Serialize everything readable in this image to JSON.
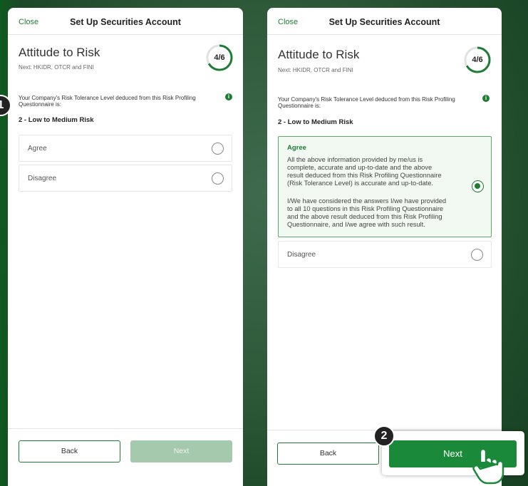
{
  "colors": {
    "brand_green": "#1e7d34",
    "next_active": "#1a8a3a",
    "next_disabled": "#a5c9ad",
    "background": "#2e5a3a"
  },
  "left_screen": {
    "close_label": "Close",
    "title": "Set Up Securities Account",
    "step_title": "Attitude to Risk",
    "step_next": "Next: HKIDR, OTCR and FINI",
    "progress_label": "4/6",
    "progress_fraction": 0.667,
    "question": "Your Company's Risk Tolerance Level deduced from this Risk Profiling Questionnaire is:",
    "info_icon": "info-icon",
    "result": "2 - Low to Medium Risk",
    "options": [
      {
        "label": "Agree",
        "selected": false
      },
      {
        "label": "Disagree",
        "selected": false
      }
    ],
    "back_label": "Back",
    "next_label": "Next",
    "badge": "1"
  },
  "right_screen": {
    "close_label": "Close",
    "title": "Set Up Securities Account",
    "step_title": "Attitude to Risk",
    "step_next": "Next: HKIDR, OTCR and FINI",
    "progress_label": "4/6",
    "progress_fraction": 0.667,
    "question": "Your Company's Risk Tolerance Level deduced from this Risk Profiling Questionnaire is:",
    "result": "2 - Low to Medium Risk",
    "agree": {
      "label": "Agree",
      "line1": "All the above information provided by me/us is",
      "line2": "complete, accurate and up-to-date and the above",
      "line3": "result deduced from this Risk Profiling Questionnaire",
      "line4": "(Risk Tolerance Level) is accurate and up-to-date.",
      "line5": "I/We have considered the answers I/we have provided",
      "line6": "to all 10 questions in this Risk Profiling Questionnaire",
      "line7": "and the above result deduced from this Risk Profiling",
      "line8": "Questionnaire, and I/we agree with such result.",
      "selected": true
    },
    "disagree": {
      "label": "Disagree",
      "selected": false
    },
    "back_label": "Back",
    "next_label": "Next",
    "badge": "2"
  }
}
